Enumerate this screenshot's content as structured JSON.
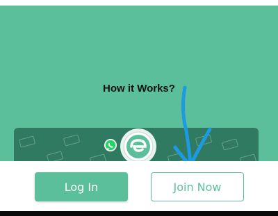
{
  "hero": {
    "title": "How it Works?"
  },
  "video": {
    "thumbnail_icons": [
      "whatsapp-icon",
      "app-logo-icon"
    ]
  },
  "actions": {
    "login_label": "Log In",
    "join_label": "Join Now"
  },
  "colors": {
    "brand_green": "#5bbf9b",
    "dark_green": "#2f7a61",
    "annotation_blue": "#1e9be0"
  }
}
